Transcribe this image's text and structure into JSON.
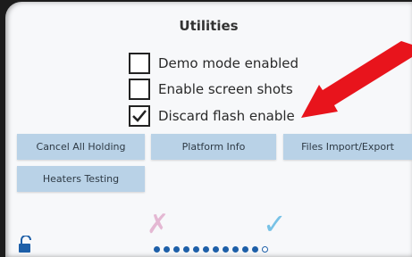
{
  "title": "Utilities",
  "options": [
    {
      "label": "Demo mode enabled",
      "checked": false
    },
    {
      "label": "Enable screen shots",
      "checked": false
    },
    {
      "label": "Discard flash enable",
      "checked": true
    }
  ],
  "buttons": {
    "cancel_all_holding": "Cancel All Holding",
    "platform_info": "Platform Info",
    "files_import_export": "Files Import/Export",
    "heaters_testing": "Heaters Testing"
  },
  "footer": {
    "cancel_icon": "x-icon",
    "confirm_icon": "check-icon",
    "lock_icon": "unlocked-padlock-icon",
    "page_dots_total": 12,
    "page_dots_filled": 11
  },
  "colors": {
    "button_bg": "#b9d2e7",
    "annotation_arrow": "#e8141c",
    "cancel_mark": "#e4b8d3",
    "confirm_mark": "#78c2e6",
    "dots": "#1d5fa8"
  }
}
